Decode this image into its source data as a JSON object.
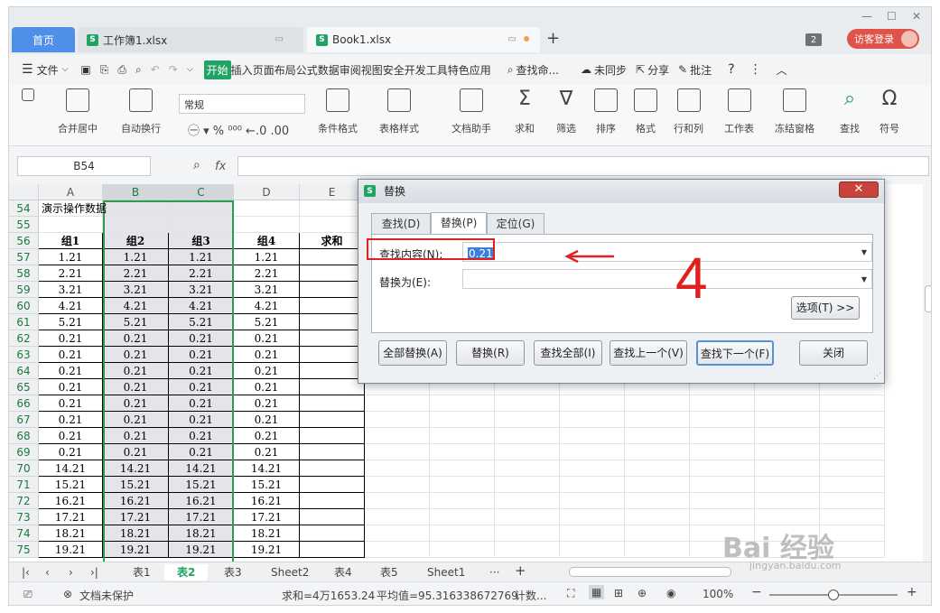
{
  "tabs": {
    "home": "首页",
    "doc1": "工作簿1.xlsx",
    "doc2": "Book1.xlsx",
    "badge": "2",
    "login": "访客登录"
  },
  "menu": {
    "file": "文件",
    "items": [
      "开始",
      "插入",
      "页面布局",
      "公式",
      "数据",
      "审阅",
      "视图",
      "安全",
      "开发工具",
      "特色应用"
    ],
    "search": "查找命...",
    "sync": "未同步",
    "share": "分享",
    "annotate": "批注"
  },
  "ribbon": {
    "merge": "合并居中",
    "wrap": "自动换行",
    "format_value": "常规",
    "cond_format": "条件格式",
    "table_style": "表格样式",
    "doc_helper": "文档助手",
    "sum": "求和",
    "filter": "筛选",
    "sort": "排序",
    "format": "格式",
    "rowcol": "行和列",
    "sheet": "工作表",
    "freeze": "冻结窗格",
    "find": "查找",
    "symbol": "符号"
  },
  "formula": {
    "namebox": "B54",
    "fx": "fx"
  },
  "grid": {
    "columns": [
      "A",
      "B",
      "C",
      "D",
      "E"
    ],
    "rows": [
      {
        "n": "54",
        "cells": [
          "演示操作数据",
          "",
          "",
          "",
          ""
        ]
      },
      {
        "n": "55",
        "cells": [
          "",
          "",
          "",
          "",
          ""
        ]
      },
      {
        "n": "56",
        "cells": [
          "组1",
          "组2",
          "组3",
          "组4",
          "求和"
        ]
      },
      {
        "n": "57",
        "cells": [
          "1.21",
          "1.21",
          "1.21",
          "1.21",
          ""
        ]
      },
      {
        "n": "58",
        "cells": [
          "2.21",
          "2.21",
          "2.21",
          "2.21",
          ""
        ]
      },
      {
        "n": "59",
        "cells": [
          "3.21",
          "3.21",
          "3.21",
          "3.21",
          ""
        ]
      },
      {
        "n": "60",
        "cells": [
          "4.21",
          "4.21",
          "4.21",
          "4.21",
          ""
        ]
      },
      {
        "n": "61",
        "cells": [
          "5.21",
          "5.21",
          "5.21",
          "5.21",
          ""
        ]
      },
      {
        "n": "62",
        "cells": [
          "0.21",
          "0.21",
          "0.21",
          "0.21",
          ""
        ]
      },
      {
        "n": "63",
        "cells": [
          "0.21",
          "0.21",
          "0.21",
          "0.21",
          ""
        ]
      },
      {
        "n": "64",
        "cells": [
          "0.21",
          "0.21",
          "0.21",
          "0.21",
          ""
        ]
      },
      {
        "n": "65",
        "cells": [
          "0.21",
          "0.21",
          "0.21",
          "0.21",
          ""
        ]
      },
      {
        "n": "66",
        "cells": [
          "0.21",
          "0.21",
          "0.21",
          "0.21",
          ""
        ]
      },
      {
        "n": "67",
        "cells": [
          "0.21",
          "0.21",
          "0.21",
          "0.21",
          ""
        ]
      },
      {
        "n": "68",
        "cells": [
          "0.21",
          "0.21",
          "0.21",
          "0.21",
          ""
        ]
      },
      {
        "n": "69",
        "cells": [
          "0.21",
          "0.21",
          "0.21",
          "0.21",
          ""
        ]
      },
      {
        "n": "70",
        "cells": [
          "14.21",
          "14.21",
          "14.21",
          "14.21",
          ""
        ]
      },
      {
        "n": "71",
        "cells": [
          "15.21",
          "15.21",
          "15.21",
          "15.21",
          ""
        ]
      },
      {
        "n": "72",
        "cells": [
          "16.21",
          "16.21",
          "16.21",
          "16.21",
          ""
        ]
      },
      {
        "n": "73",
        "cells": [
          "17.21",
          "17.21",
          "17.21",
          "17.21",
          ""
        ]
      },
      {
        "n": "74",
        "cells": [
          "18.21",
          "18.21",
          "18.21",
          "18.21",
          ""
        ]
      },
      {
        "n": "75",
        "cells": [
          "19.21",
          "19.21",
          "19.21",
          "19.21",
          ""
        ]
      }
    ]
  },
  "sheets": [
    "表1",
    "表2",
    "表3",
    "Sheet2",
    "表4",
    "表5",
    "Sheet1"
  ],
  "status": {
    "protect": "文档未保护",
    "sum": "求和=4万1653.24",
    "avg": "平均值=95.316338672769",
    "count": "计数...",
    "zoom": "100%"
  },
  "dialog": {
    "title": "替换",
    "tabs": [
      "查找(D)",
      "替换(P)",
      "定位(G)"
    ],
    "find_label": "查找内容(N):",
    "find_value": "0.21",
    "replace_label": "替换为(E):",
    "replace_value": "",
    "options": "选项(T) >>",
    "buttons": [
      "全部替换(A)",
      "替换(R)",
      "查找全部(I)",
      "查找上一个(V)",
      "查找下一个(F)",
      "关闭"
    ]
  },
  "annotation": {
    "step": "4",
    "color": "#e02020"
  },
  "watermark": {
    "main": "Bai 经验",
    "sub": "jingyan.baidu.com"
  }
}
